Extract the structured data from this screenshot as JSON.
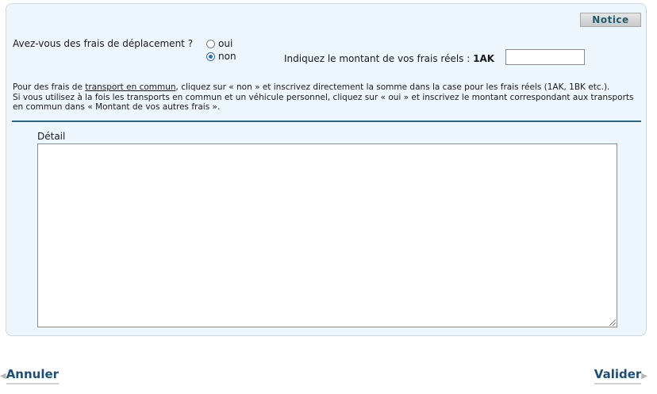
{
  "notice_label": "Notice",
  "question": "Avez-vous des frais de déplacement ?",
  "radios": [
    {
      "label": "oui",
      "checked": false
    },
    {
      "label": "non",
      "checked": true
    }
  ],
  "amount": {
    "label": "Indiquez le montant de vos frais réels : ",
    "code": "1AK",
    "value": ""
  },
  "info": {
    "line1_prefix": "Pour des frais de ",
    "line1_link": "transport en commun",
    "line1_suffix": ", cliquez sur « non » et inscrivez directement la somme dans la case pour les frais réels (1AK, 1BK etc.).",
    "line2": "Si vous utilisez à la fois les transports en commun et un véhicule personnel, cliquez sur « oui » et inscrivez le montant correspondant aux transports en commun dans « Montant de vos autres frais »."
  },
  "detail_label": "Détail",
  "cancel_label": "Annuler",
  "submit_label": "Valider",
  "colors": {
    "accent": "#2a6986",
    "link": "#1c4f78",
    "panel_bg": "#eef6fd"
  }
}
